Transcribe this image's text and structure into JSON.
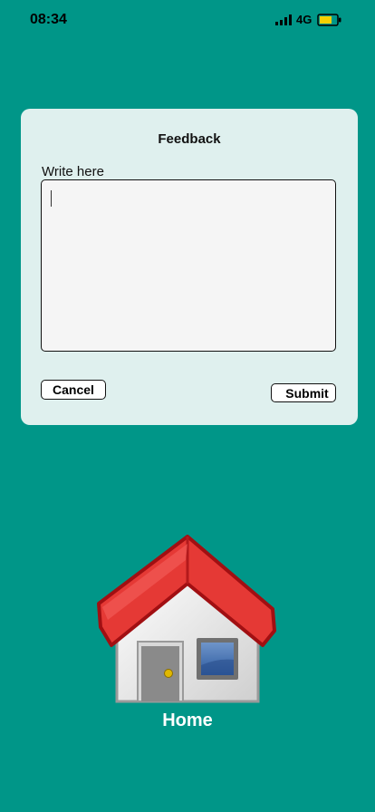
{
  "status_bar": {
    "time": "08:34",
    "network": "4G",
    "signal_icon": "signal-bars",
    "battery_icon": "battery-low"
  },
  "feedback": {
    "title": "Feedback",
    "input_label": "Write here",
    "input_value": "",
    "cancel_label": "Cancel",
    "submit_label": "Submit"
  },
  "home": {
    "label": "Home",
    "icon": "house"
  },
  "colors": {
    "background": "#009688",
    "card": "#dff0ee",
    "roof": "#e53935",
    "battery": "#f5d000"
  }
}
